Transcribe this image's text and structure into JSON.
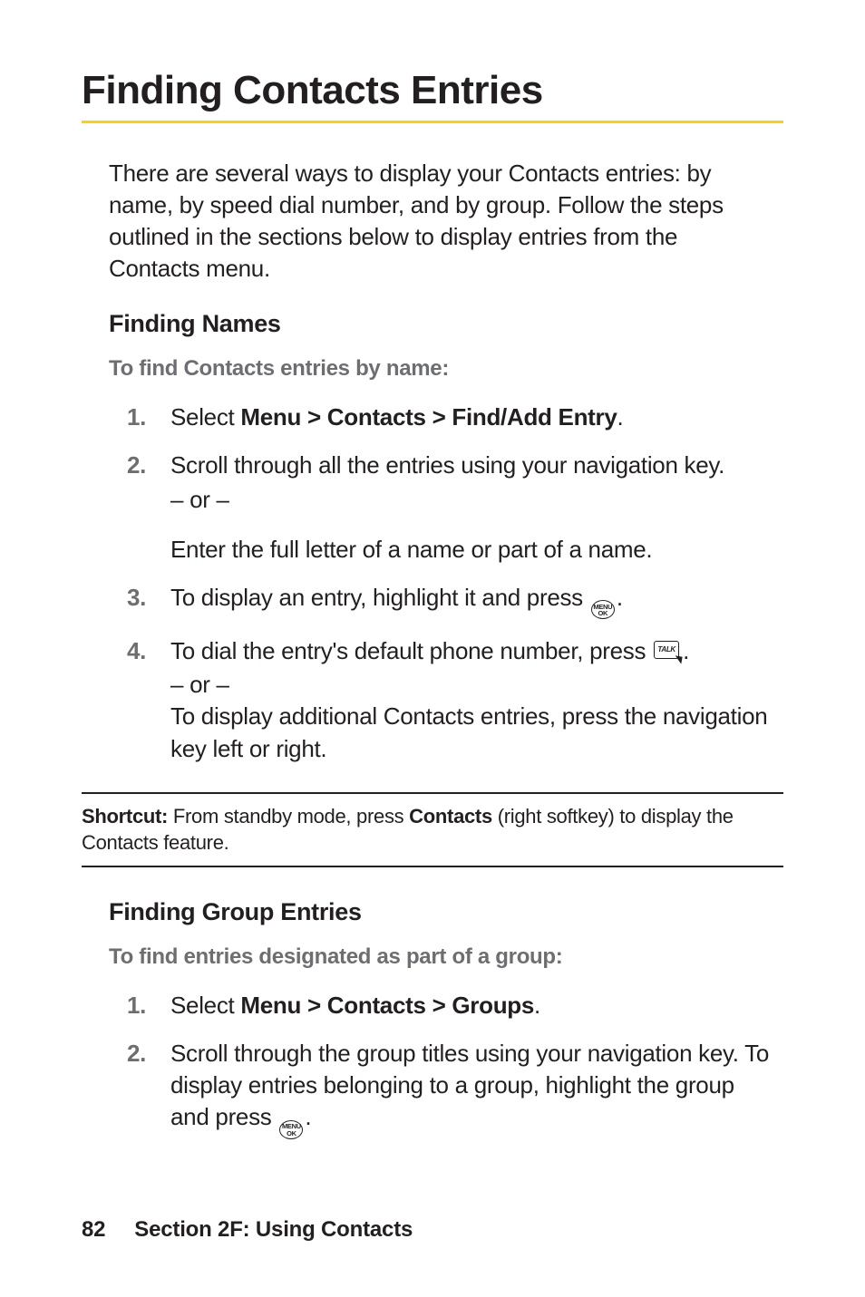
{
  "title": "Finding Contacts Entries",
  "intro": "There are several ways to display your Contacts entries: by name, by speed dial number, and by group. Follow the steps outlined in the sections below to display entries from the Contacts menu.",
  "sectionA": {
    "heading": "Finding Names",
    "leadin": "To find Contacts entries by name:",
    "steps": {
      "s1_pre": "Select ",
      "s1_bold": "Menu > Contacts > Find/Add Entry",
      "s1_post": ".",
      "s2_line1": "Scroll through all the entries using your navigation key.",
      "s2_or": "– or –",
      "s2_line2": "Enter the full letter of a name or part of a name.",
      "s3_pre": "To display an entry, highlight it and press ",
      "s3_post": ".",
      "s4_pre": "To dial the entry's default phone number, press ",
      "s4_post": ".",
      "s4_or": "– or –",
      "s4_line2": "To display additional Contacts entries, press the navigation key left or right."
    }
  },
  "shortcut": {
    "label": "Shortcut:",
    "pre": " From standby mode, press ",
    "bold": "Contacts",
    "post": " (right softkey) to display the Contacts feature."
  },
  "sectionB": {
    "heading": "Finding Group Entries",
    "leadin": "To find entries designated as part of a group:",
    "steps": {
      "s1_pre": "Select ",
      "s1_bold": "Menu > Contacts > Groups",
      "s1_post": ".",
      "s2_line1": "Scroll through the group titles using your navigation key. To display entries belonging to a group, highlight the group and press ",
      "s2_post": "."
    }
  },
  "icons": {
    "menu_top": "MENU",
    "menu_bottom": "OK",
    "talk": "TALK"
  },
  "nums": {
    "n1": "1.",
    "n2": "2.",
    "n3": "3.",
    "n4": "4."
  },
  "footer": {
    "page": "82",
    "section": "Section 2F: Using Contacts"
  }
}
